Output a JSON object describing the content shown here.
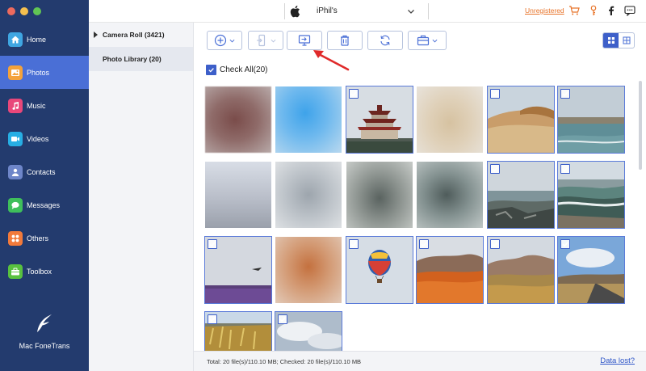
{
  "window": {
    "traffic_lights": [
      "#ed6a5e",
      "#f5bf4f",
      "#61c554"
    ]
  },
  "sidebar": {
    "items": [
      {
        "label": "Home",
        "icon": "home-icon",
        "color": "#3fa6e2",
        "active": false
      },
      {
        "label": "Photos",
        "icon": "photos-icon",
        "color": "#f4a23a",
        "active": true
      },
      {
        "label": "Music",
        "icon": "music-icon",
        "color": "#e9477a",
        "active": false
      },
      {
        "label": "Videos",
        "icon": "videos-icon",
        "color": "#27aee4",
        "active": false
      },
      {
        "label": "Contacts",
        "icon": "contacts-icon",
        "color": "#6e86c9",
        "active": false
      },
      {
        "label": "Messages",
        "icon": "messages-icon",
        "color": "#3fbf5b",
        "active": false
      },
      {
        "label": "Others",
        "icon": "others-icon",
        "color": "#f27a3b",
        "active": false
      },
      {
        "label": "Toolbox",
        "icon": "toolbox-icon",
        "color": "#58c13f",
        "active": false
      }
    ],
    "brand_name": "Mac FoneTrans"
  },
  "titlebar": {
    "device_name": "iPhil's",
    "unregistered": "Unregistered",
    "accent": "#e8742a"
  },
  "albums": {
    "camera_roll": "Camera Roll (3421)",
    "photo_library": "Photo Library (20)"
  },
  "toolbar": {
    "buttons": [
      "add-icon",
      "export-to-device-icon",
      "export-to-pc-icon",
      "delete-icon",
      "refresh-icon",
      "toolbox-icon"
    ]
  },
  "check_all": {
    "label": "Check All(20)",
    "checked": true
  },
  "photos": [
    {
      "scene": "blurred-red",
      "checked": false
    },
    {
      "scene": "blurred-blue",
      "checked": false
    },
    {
      "scene": "pagoda",
      "checked": true
    },
    {
      "scene": "blurred-beige",
      "checked": false
    },
    {
      "scene": "beach-dunes",
      "checked": true
    },
    {
      "scene": "sea-coast",
      "checked": true
    },
    {
      "scene": "blurred-pale",
      "checked": false
    },
    {
      "scene": "blurred-grey",
      "checked": false
    },
    {
      "scene": "blurred-dark",
      "checked": false
    },
    {
      "scene": "blurred-dark2",
      "checked": false
    },
    {
      "scene": "rocky-shore",
      "checked": true
    },
    {
      "scene": "wave-shore",
      "checked": true
    },
    {
      "scene": "lavender-field",
      "checked": true
    },
    {
      "scene": "blurred-orange",
      "checked": false
    },
    {
      "scene": "hot-air-balloon",
      "checked": true
    },
    {
      "scene": "orange-field-hills",
      "checked": true
    },
    {
      "scene": "dry-grass-hills",
      "checked": true
    },
    {
      "scene": "desert-road",
      "checked": true
    },
    {
      "scene": "golden-grass",
      "checked": true
    },
    {
      "scene": "cloudy-sky",
      "checked": true
    }
  ],
  "footer": {
    "status": "Total: 20 file(s)/110.10 MB; Checked: 20 file(s)/110.10 MB",
    "data_lost": "Data lost?",
    "link_color": "#2f56c8"
  }
}
